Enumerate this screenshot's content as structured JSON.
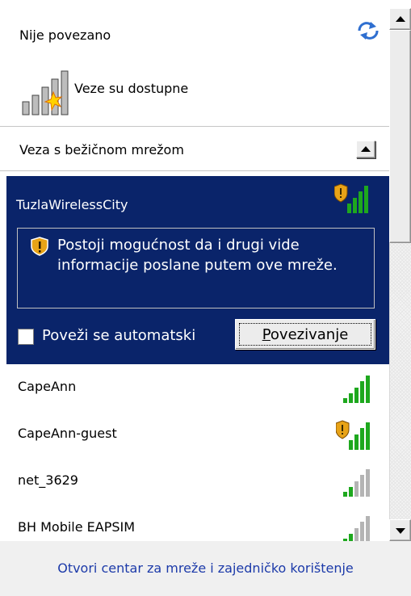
{
  "status": {
    "title": "Nije povezano",
    "subtitle": "Veze su dostupne",
    "refresh_icon": "refresh-icon",
    "status_icon": "signal-star-icon"
  },
  "section": {
    "title": "Veza s bežičnom mrežom"
  },
  "selected_network": {
    "name": "TuzlaWirelessCity",
    "secured": false,
    "signal_bars": 4,
    "warning": "Postoji mogućnost da i drugi vide informacije poslane putem ove mreže.",
    "auto_connect_label": "Poveži se automatski",
    "auto_connect_checked": false,
    "connect_button_first": "P",
    "connect_button_rest": "ovezivanje"
  },
  "networks": [
    {
      "name": "CapeAnn",
      "shield": false,
      "signal_bars": 4
    },
    {
      "name": "CapeAnn-guest",
      "shield": true,
      "signal_bars": 4
    },
    {
      "name": "net_3629",
      "shield": false,
      "signal_bars": 2
    },
    {
      "name": "BH Mobile EAPSIM",
      "shield": false,
      "signal_bars": 2
    }
  ],
  "footer": {
    "link": "Otvori centar za mreže i zajedničko korištenje"
  },
  "colors": {
    "selected_bg": "#0a246a",
    "signal_green": "#1ea81e",
    "signal_gray": "#b4b4b4",
    "link": "#1c3aa9",
    "shield_gold": "#e8a317"
  }
}
